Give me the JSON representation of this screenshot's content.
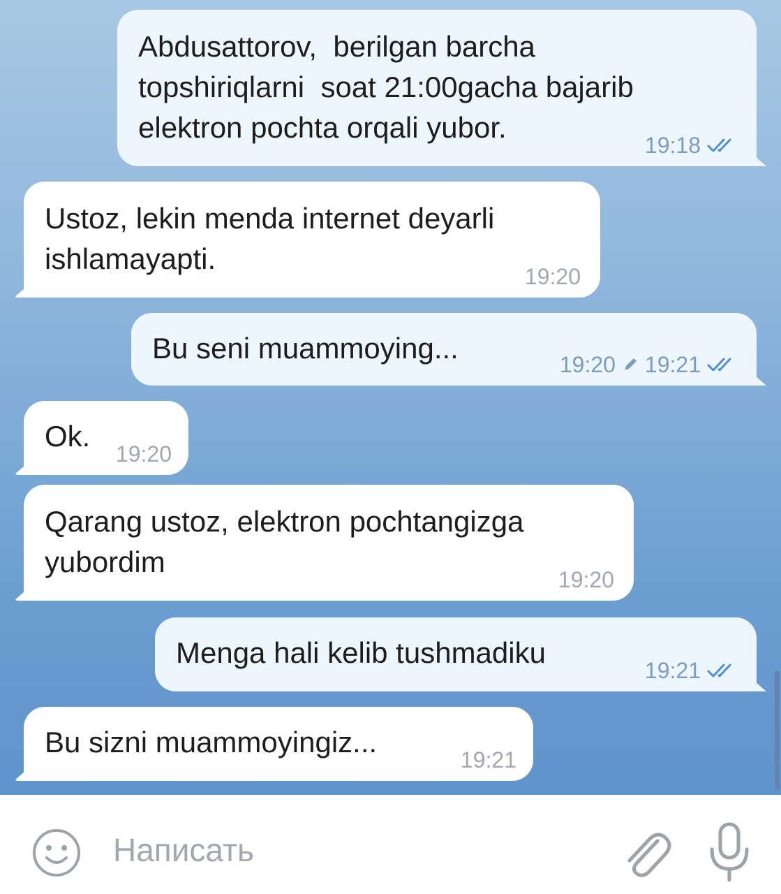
{
  "messages": [
    {
      "direction": "out",
      "text": "Abdusattorov,  berilgan barcha\ntopshiriqlarni  soat 21:00gacha bajarib\nelektron pochta orqali yubor.",
      "time": "19:18",
      "status": "double-check-icon"
    },
    {
      "direction": "in",
      "text": "Ustoz, lekin menda internet deyarli\nishlamayapti.",
      "time": "19:20"
    },
    {
      "direction": "out",
      "text": "Bu seni muammoying...",
      "edited_time": "19:20",
      "time": "19:21",
      "status": "double-check-icon"
    },
    {
      "direction": "in",
      "text": "Ok.",
      "time": "19:20"
    },
    {
      "direction": "in",
      "text": "Qarang ustoz, elektron pochtangizga\nyubordim",
      "time": "19:20"
    },
    {
      "direction": "out",
      "text": "Menga hali kelib tushmadiku",
      "time": "19:21",
      "status": "double-check-icon"
    },
    {
      "direction": "in",
      "text": "Bu sizni muammoyingiz...",
      "time": "19:21"
    }
  ],
  "composer": {
    "placeholder": "Написать",
    "left_icon": "emoji-smile-icon",
    "right_icons": [
      "paperclip-icon",
      "microphone-icon"
    ]
  },
  "colors": {
    "outgoing_bubble": "#eef6fd",
    "incoming_bubble": "#ffffff",
    "check_marks": "#4f8fd0",
    "chat_background": "#8fb6dc"
  }
}
